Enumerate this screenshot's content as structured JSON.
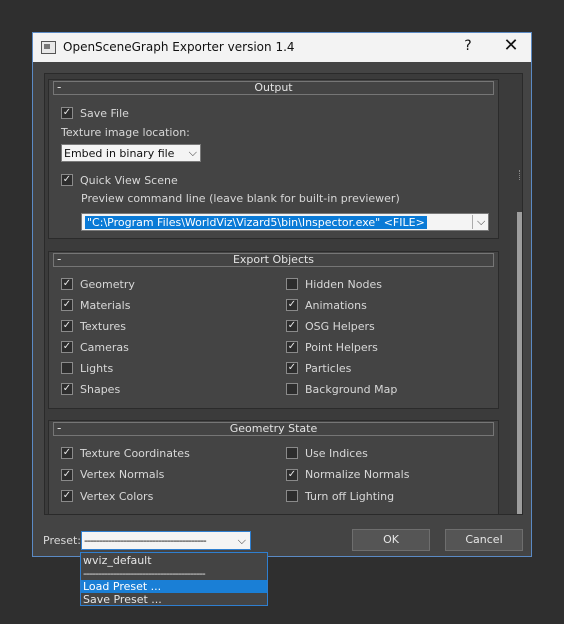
{
  "window": {
    "title": "OpenSceneGraph Exporter version 1.4",
    "help_label": "?",
    "close_label": "✕"
  },
  "output": {
    "header": "Output",
    "collapse": "-",
    "save_file": {
      "label": "Save File",
      "checked": true
    },
    "texture_location_label": "Texture image location:",
    "texture_location_value": "Embed in binary file",
    "quick_view": {
      "label": "Quick View Scene",
      "checked": true
    },
    "preview_label": "Preview command line (leave blank for built-in previewer)",
    "preview_value": "\"C:\\Program Files\\WorldViz\\Vizard5\\bin\\Inspector.exe\" <FILE>"
  },
  "export_objects": {
    "header": "Export Objects",
    "collapse": "-",
    "left": [
      {
        "label": "Geometry",
        "checked": true
      },
      {
        "label": "Materials",
        "checked": true
      },
      {
        "label": "Textures",
        "checked": true
      },
      {
        "label": "Cameras",
        "checked": true
      },
      {
        "label": "Lights",
        "checked": false
      },
      {
        "label": "Shapes",
        "checked": true
      }
    ],
    "right": [
      {
        "label": "Hidden Nodes",
        "checked": false
      },
      {
        "label": "Animations",
        "checked": true
      },
      {
        "label": "OSG Helpers",
        "checked": true
      },
      {
        "label": "Point Helpers",
        "checked": true
      },
      {
        "label": "Particles",
        "checked": true
      },
      {
        "label": "Background Map",
        "checked": false
      }
    ]
  },
  "geometry_state": {
    "header": "Geometry State",
    "collapse": "-",
    "left": [
      {
        "label": "Texture Coordinates",
        "checked": true
      },
      {
        "label": "Vertex Normals",
        "checked": true
      },
      {
        "label": "Vertex Colors",
        "checked": true
      }
    ],
    "right": [
      {
        "label": "Use Indices",
        "checked": false
      },
      {
        "label": "Normalize Normals",
        "checked": true
      },
      {
        "label": "Turn off Lighting",
        "checked": false
      }
    ]
  },
  "footer": {
    "preset_label": "Preset:",
    "preset_value": "-----------------------------------------",
    "ok_label": "OK",
    "cancel_label": "Cancel"
  },
  "preset_menu": {
    "items": [
      "wviz_default",
      "-----------------------------------------",
      "Load Preset ...",
      "Save Preset ..."
    ],
    "highlighted_index": 2
  },
  "colors": {
    "accent": "#0a7ad6",
    "panel": "#444444",
    "frame": "#5b8ac4"
  }
}
